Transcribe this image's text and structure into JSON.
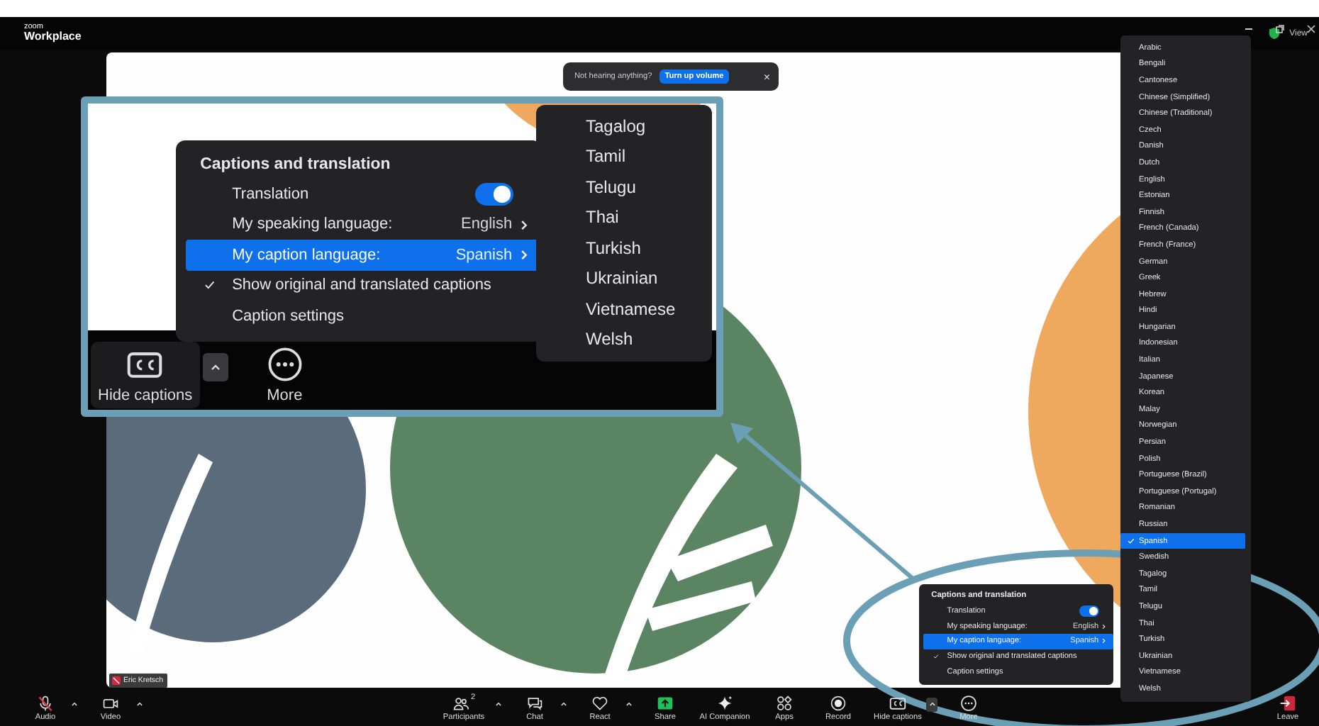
{
  "title_bar": {
    "logo_top": "zoom",
    "logo_bottom": "Workplace",
    "view": "View"
  },
  "toast": {
    "message": "Not hearing anything?",
    "button": "Turn up volume",
    "close": "×"
  },
  "name_tag": {
    "name": "Eric Kretsch",
    "muted": true
  },
  "callout": {
    "caption_menu": {
      "title": "Captions and translation",
      "items": [
        {
          "kind": "toggle",
          "label": "Translation",
          "on": true,
          "selected": false
        },
        {
          "kind": "submenu",
          "label": "My speaking language:",
          "value": "English",
          "selected": false
        },
        {
          "kind": "submenu",
          "label": "My caption language:",
          "value": "Spanish",
          "selected": true
        },
        {
          "kind": "check",
          "label": "Show original and translated captions",
          "checked": true,
          "selected": false
        },
        {
          "kind": "plain",
          "label": "Caption settings",
          "selected": false
        }
      ]
    },
    "submenu": [
      "Tagalog",
      "Tamil",
      "Telugu",
      "Thai",
      "Turkish",
      "Ukrainian",
      "Vietnamese",
      "Welsh"
    ],
    "buttons": [
      {
        "label": "Hide captions",
        "kind": "cc",
        "caret": true
      },
      {
        "label": "More",
        "kind": "more"
      }
    ]
  },
  "caption_menu": {
    "title": "Captions and translation",
    "items": [
      {
        "kind": "toggle",
        "label": "Translation",
        "on": true,
        "selected": false
      },
      {
        "kind": "submenu",
        "label": "My speaking language:",
        "value": "English",
        "selected": false
      },
      {
        "kind": "submenu",
        "label": "My caption language:",
        "value": "Spanish",
        "selected": true
      },
      {
        "kind": "check",
        "label": "Show original and translated captions",
        "checked": true,
        "selected": false
      },
      {
        "kind": "plain",
        "label": "Caption settings",
        "selected": false
      }
    ]
  },
  "language_list": [
    {
      "label": "Arabic",
      "selected": false
    },
    {
      "label": "Bengali",
      "selected": false
    },
    {
      "label": "Cantonese",
      "selected": false
    },
    {
      "label": "Chinese (Simplified)",
      "selected": false
    },
    {
      "label": "Chinese (Traditional)",
      "selected": false
    },
    {
      "label": "Czech",
      "selected": false
    },
    {
      "label": "Danish",
      "selected": false
    },
    {
      "label": "Dutch",
      "selected": false
    },
    {
      "label": "English",
      "selected": false
    },
    {
      "label": "Estonian",
      "selected": false
    },
    {
      "label": "Finnish",
      "selected": false
    },
    {
      "label": "French (Canada)",
      "selected": false
    },
    {
      "label": "French (France)",
      "selected": false
    },
    {
      "label": "German",
      "selected": false
    },
    {
      "label": "Greek",
      "selected": false
    },
    {
      "label": "Hebrew",
      "selected": false
    },
    {
      "label": "Hindi",
      "selected": false
    },
    {
      "label": "Hungarian",
      "selected": false
    },
    {
      "label": "Indonesian",
      "selected": false
    },
    {
      "label": "Italian",
      "selected": false
    },
    {
      "label": "Japanese",
      "selected": false
    },
    {
      "label": "Korean",
      "selected": false
    },
    {
      "label": "Malay",
      "selected": false
    },
    {
      "label": "Norwegian",
      "selected": false
    },
    {
      "label": "Persian",
      "selected": false
    },
    {
      "label": "Polish",
      "selected": false
    },
    {
      "label": "Portuguese (Brazil)",
      "selected": false
    },
    {
      "label": "Portuguese (Portugal)",
      "selected": false
    },
    {
      "label": "Romanian",
      "selected": false
    },
    {
      "label": "Russian",
      "selected": false
    },
    {
      "label": "Spanish",
      "selected": true
    },
    {
      "label": "Swedish",
      "selected": false
    },
    {
      "label": "Tagalog",
      "selected": false
    },
    {
      "label": "Tamil",
      "selected": false
    },
    {
      "label": "Telugu",
      "selected": false
    },
    {
      "label": "Thai",
      "selected": false
    },
    {
      "label": "Turkish",
      "selected": false
    },
    {
      "label": "Ukrainian",
      "selected": false
    },
    {
      "label": "Vietnamese",
      "selected": false
    },
    {
      "label": "Welsh",
      "selected": false
    }
  ],
  "toolbar": {
    "left": [
      {
        "label": "Audio",
        "kind": "mic",
        "muted": true,
        "caret": true
      },
      {
        "label": "Video",
        "kind": "video",
        "caret": true
      }
    ],
    "center": [
      {
        "label": "Participants",
        "kind": "people",
        "count": "2",
        "caret": true
      },
      {
        "label": "Chat",
        "kind": "chat",
        "caret": true
      },
      {
        "label": "React",
        "kind": "heart",
        "caret": true
      },
      {
        "label": "Share",
        "kind": "share"
      },
      {
        "label": "AI Companion",
        "kind": "sparkle"
      },
      {
        "label": "Apps",
        "kind": "apps"
      },
      {
        "label": "Record",
        "kind": "record"
      },
      {
        "label": "Hide captions",
        "kind": "cc",
        "caret": true
      },
      {
        "label": "More",
        "kind": "more"
      }
    ],
    "right": [
      {
        "label": "Leave",
        "kind": "leave"
      }
    ]
  }
}
